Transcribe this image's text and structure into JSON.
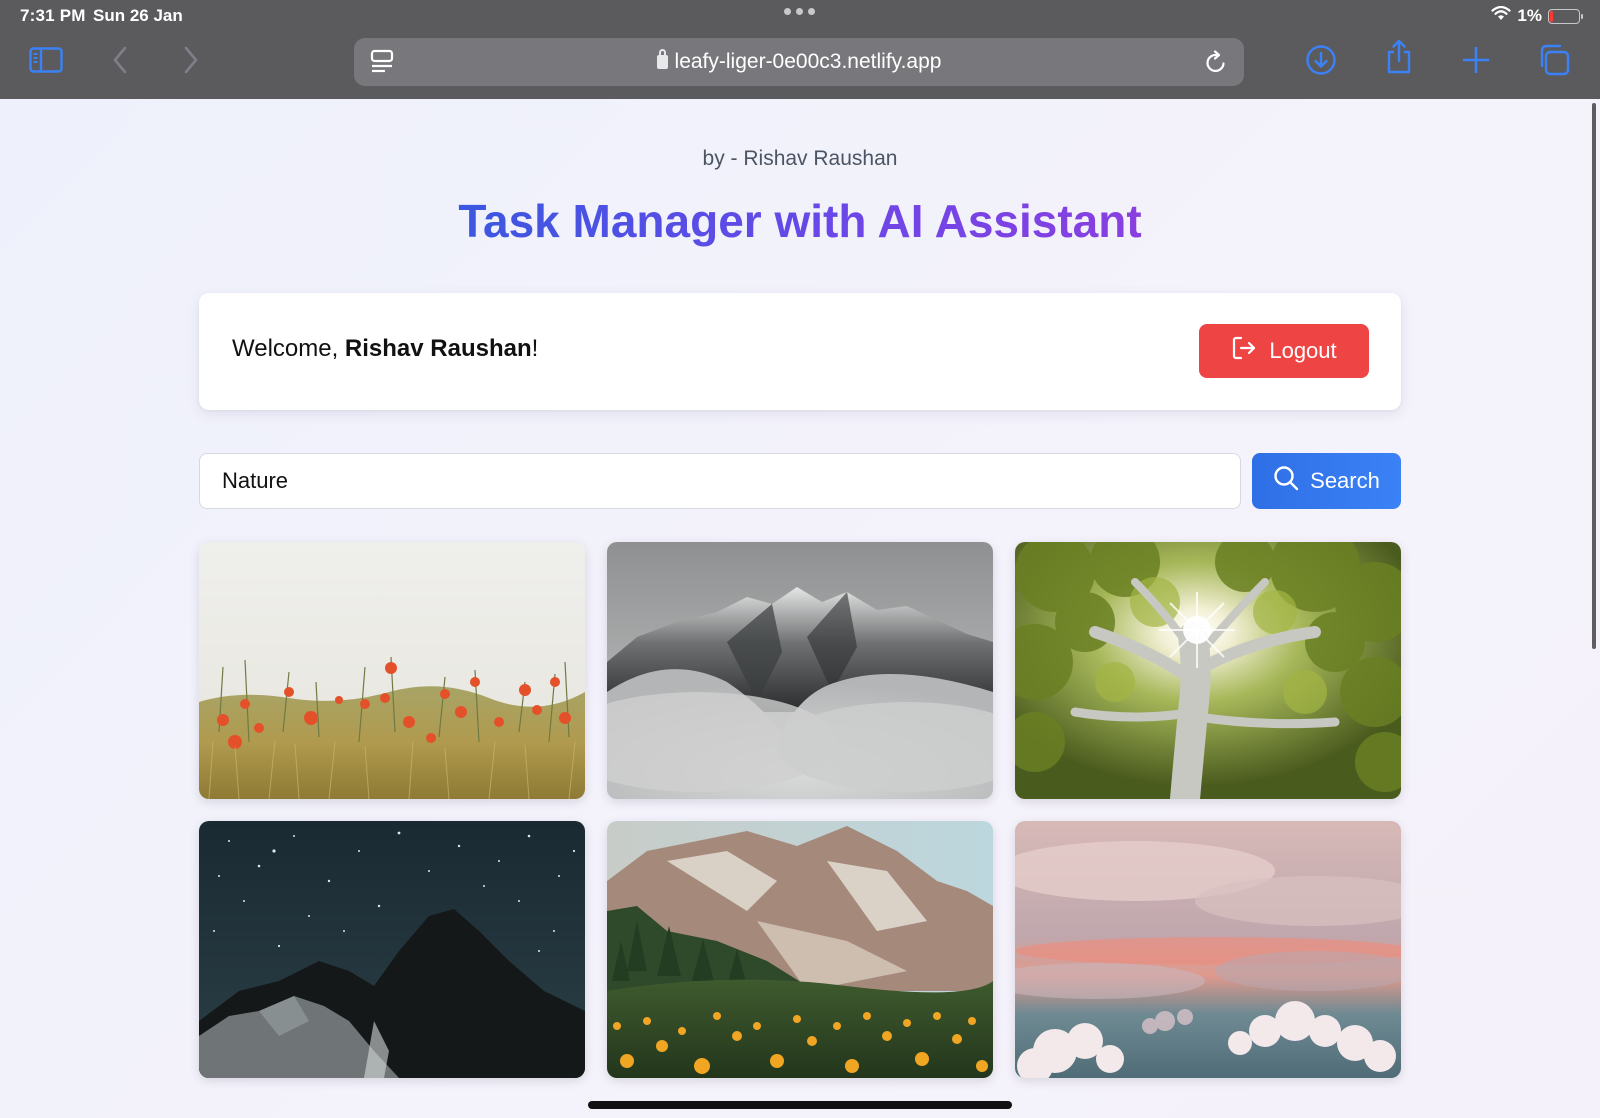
{
  "status_bar": {
    "time": "7:31 PM",
    "date": "Sun 26 Jan",
    "battery": "1%",
    "icons": [
      "wifi-icon",
      "battery-icon"
    ]
  },
  "browser": {
    "url": "leafy-liger-0e00c3.netlify.app",
    "toolbar_icons": [
      "sidebar-icon",
      "back-icon",
      "forward-icon",
      "reader-icon",
      "reload-icon",
      "download-icon",
      "share-icon",
      "plus-icon",
      "tabs-icon"
    ],
    "accent_color": "#3b82f6"
  },
  "header": {
    "byline": "by - Rishav Raushan",
    "title": "Task Manager with AI Assistant"
  },
  "welcome": {
    "greeting": "Welcome, ",
    "user_name": "Rishav Raushan",
    "suffix": "!",
    "logout_label": "Logout",
    "logout_color": "#ef4444"
  },
  "search": {
    "value": "Nature",
    "button_label": "Search",
    "button_color": "#3b82f6"
  },
  "gallery": {
    "images": [
      {
        "subject": "poppy field"
      },
      {
        "subject": "misty mountain peak"
      },
      {
        "subject": "tree canopy with sun"
      },
      {
        "subject": "night sky over mountains"
      },
      {
        "subject": "alpine meadow with flowers"
      },
      {
        "subject": "clouds at sunset"
      }
    ]
  }
}
